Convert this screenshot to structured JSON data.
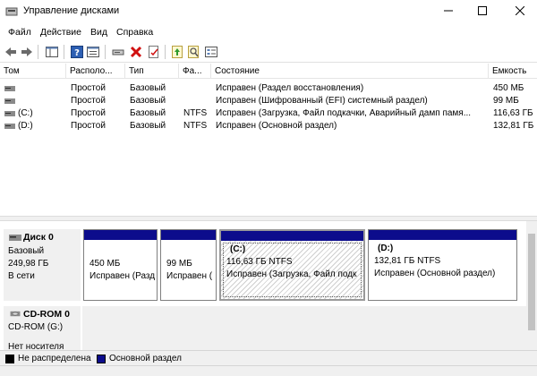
{
  "window": {
    "title": "Управление дисками"
  },
  "menu": {
    "items": [
      "Файл",
      "Действие",
      "Вид",
      "Справка"
    ]
  },
  "toolbar": {
    "buttons": [
      "back-icon",
      "forward-icon",
      "console-tree-icon",
      "help-icon",
      "properties-icon",
      "connect-icon",
      "delete-icon",
      "check-icon",
      "rescan-icon",
      "search-icon",
      "settings-icon"
    ]
  },
  "volumes": {
    "columns": [
      "Том",
      "Располо...",
      "Тип",
      "Фа...",
      "Состояние",
      "Емкость"
    ],
    "rows": [
      {
        "name": "",
        "layout": "Простой",
        "type": "Базовый",
        "fs": "",
        "status": "Исправен (Раздел восстановления)",
        "capacity": "450 МБ"
      },
      {
        "name": "",
        "layout": "Простой",
        "type": "Базовый",
        "fs": "",
        "status": "Исправен (Шифрованный (EFI) системный раздел)",
        "capacity": "99 МБ"
      },
      {
        "name": "(C:)",
        "layout": "Простой",
        "type": "Базовый",
        "fs": "NTFS",
        "status": "Исправен (Загрузка, Файл подкачки, Аварийный дамп памя...",
        "capacity": "116,63 ГБ"
      },
      {
        "name": "(D:)",
        "layout": "Простой",
        "type": "Базовый",
        "fs": "NTFS",
        "status": "Исправен (Основной раздел)",
        "capacity": "132,81 ГБ"
      }
    ]
  },
  "disk0": {
    "name": "Диск 0",
    "type": "Базовый",
    "size": "249,98 ГБ",
    "state": "В сети",
    "partitions": [
      {
        "title": "",
        "size": "450 МБ",
        "status": "Исправен (Разд"
      },
      {
        "title": "",
        "size": "99 МБ",
        "status": "Исправен ("
      },
      {
        "title": "(C:)",
        "size": "116,63 ГБ NTFS",
        "status": "Исправен (Загрузка, Файл подк"
      },
      {
        "title": "(D:)",
        "size": "132,81 ГБ NTFS",
        "status": "Исправен (Основной раздел)"
      }
    ]
  },
  "cdrom0": {
    "name": "CD-ROM 0",
    "drive": "CD-ROM (G:)",
    "media": "Нет носителя"
  },
  "legend": {
    "unallocated": "Не распределена",
    "primary": "Основной раздел",
    "unallocated_color": "#000000",
    "primary_color": "#0c0c8c"
  }
}
